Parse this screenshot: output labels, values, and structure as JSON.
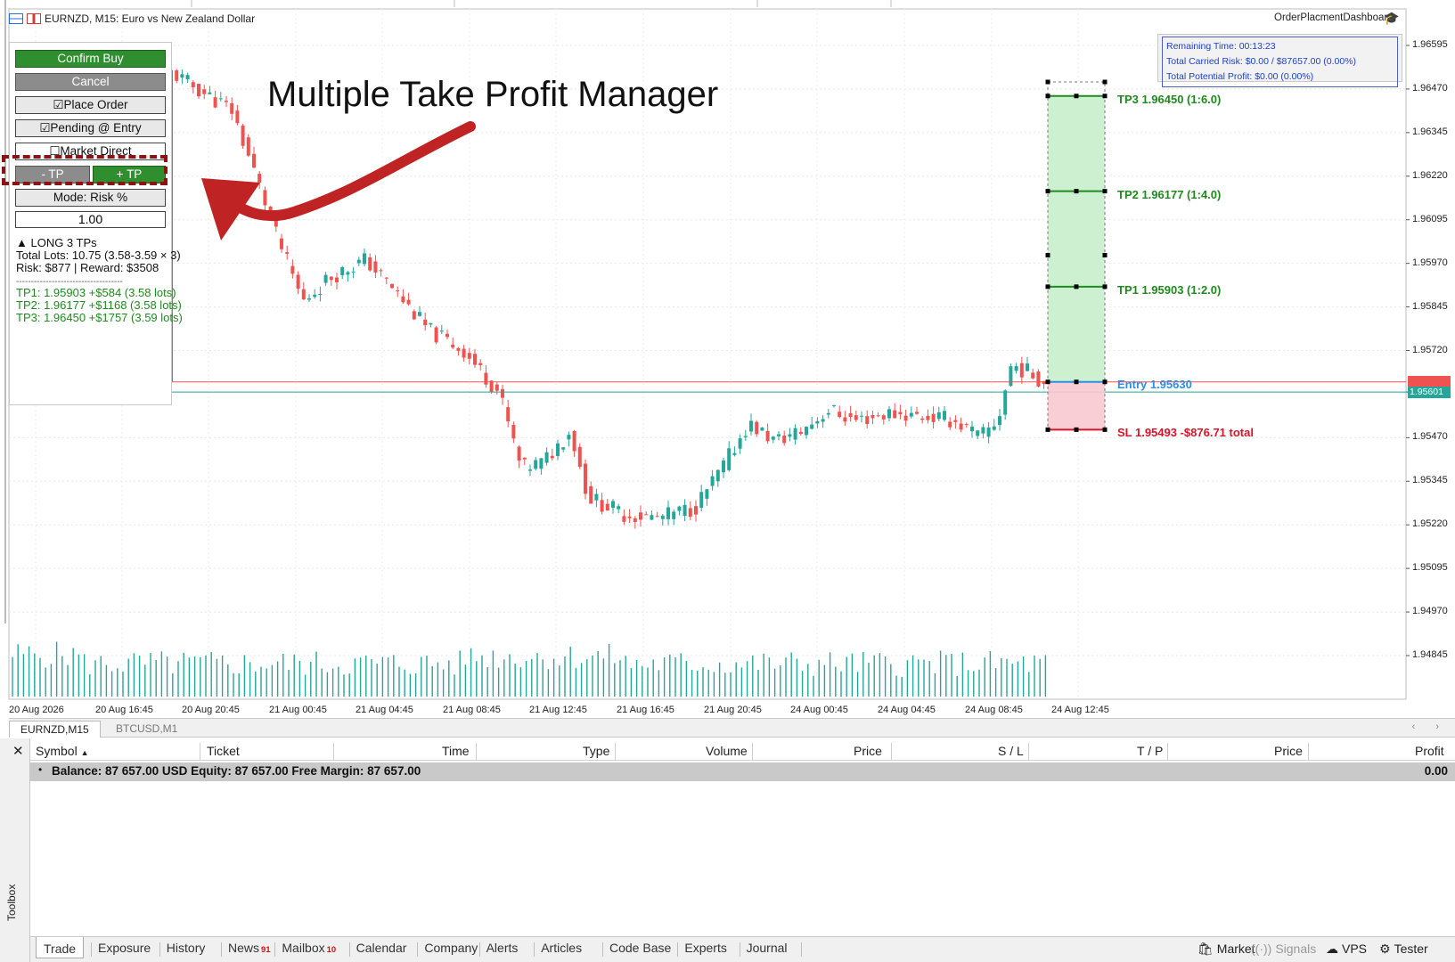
{
  "chart": {
    "title": "EURNZD, M15:  Euro vs New Zealand Dollar",
    "ea_name": "OrderPlacmentDashboard",
    "ea_icon": "graduation-cap-icon",
    "price_axis": [
      "1.96595",
      "1.96470",
      "1.96345",
      "1.96220",
      "1.96095",
      "1.95970",
      "1.95845",
      "1.95720",
      "1.95601",
      "1.95470",
      "1.95345",
      "1.95220",
      "1.95095",
      "1.94970",
      "1.94845"
    ],
    "current_price": "1.95601",
    "time_axis": [
      "20 Aug 2026",
      "20 Aug 16:45",
      "20 Aug 20:45",
      "21 Aug 00:45",
      "21 Aug 04:45",
      "21 Aug 08:45",
      "21 Aug 12:45",
      "21 Aug 16:45",
      "21 Aug 20:45",
      "24 Aug 00:45",
      "24 Aug 04:45",
      "24 Aug 08:45",
      "24 Aug 12:45"
    ],
    "colors": {
      "bull": "#26a69a",
      "bear": "#ef5350",
      "tp_zone": "#c8efcb",
      "sl_zone": "#f8c9cf",
      "entry": "#2f8de0",
      "sl": "#d6142a",
      "tp": "#1f8a1f"
    }
  },
  "info_box": {
    "remaining_time": "Remaining Time: 00:13:23",
    "carried_risk": "Total Carried Risk: $0.00 / $87657.00 (0.00%)",
    "potential_profit": "Total Potential Profit: $0.00 (0.00%)"
  },
  "levels": {
    "tp3": "TP3 1.96450 (1:6.0)",
    "tp2": "TP2 1.96177 (1:4.0)",
    "tp1": "TP1 1.95903 (1:2.0)",
    "entry": "Entry 1.95630",
    "sl": "SL 1.95493  -$876.71 total"
  },
  "panel": {
    "confirm_buy": "Confirm Buy",
    "cancel": "Cancel",
    "place_order": "☑Place Order",
    "pending_entry": "☑Pending @ Entry",
    "market_direct": "☐Market Direct",
    "minus_tp": "- TP",
    "plus_tp": "+ TP",
    "mode": "Mode: Risk %",
    "risk_value": "1.00",
    "summary_title": "▲ LONG  3 TPs",
    "total_lots": "Total Lots: 10.75 (3.58-3.59 × 3)",
    "risk_reward": "Risk: $877 | Reward: $3508",
    "separator": "------------------------------------",
    "tp_lines": [
      "TP1: 1.95903  +$584 (3.58 lots)",
      "TP2: 1.96177  +$1168 (3.58 lots)",
      "TP3: 1.96450  +$1757 (3.59 lots)"
    ]
  },
  "annotation": {
    "title": "Multiple Take Profit Manager"
  },
  "chart_tabs": [
    "EURNZD,M15",
    "BTCUSD,M1"
  ],
  "toolbox": {
    "label": "Toolbox",
    "columns": [
      "Symbol",
      "Ticket",
      "Time",
      "Type",
      "Volume",
      "Price",
      "S / L",
      "T / P",
      "Price",
      "Profit"
    ],
    "balance_row": "Balance: 87 657.00 USD  Equity: 87 657.00  Free Margin: 87 657.00",
    "balance_profit": "0.00",
    "tabs": [
      {
        "label": "Trade",
        "badge": ""
      },
      {
        "label": "Exposure",
        "badge": ""
      },
      {
        "label": "History",
        "badge": ""
      },
      {
        "label": "News",
        "badge": "91"
      },
      {
        "label": "Mailbox",
        "badge": "10"
      },
      {
        "label": "Calendar",
        "badge": ""
      },
      {
        "label": "Company",
        "badge": ""
      },
      {
        "label": "Alerts",
        "badge": ""
      },
      {
        "label": "Articles",
        "badge": ""
      },
      {
        "label": "Code Base",
        "badge": ""
      },
      {
        "label": "Experts",
        "badge": ""
      },
      {
        "label": "Journal",
        "badge": ""
      }
    ],
    "right_tools": [
      {
        "label": "Market",
        "icon": "bag-icon"
      },
      {
        "label": "Signals",
        "icon": "signal-icon"
      },
      {
        "label": "VPS",
        "icon": "cloud-icon"
      },
      {
        "label": "Tester",
        "icon": "gear-icon"
      }
    ]
  }
}
